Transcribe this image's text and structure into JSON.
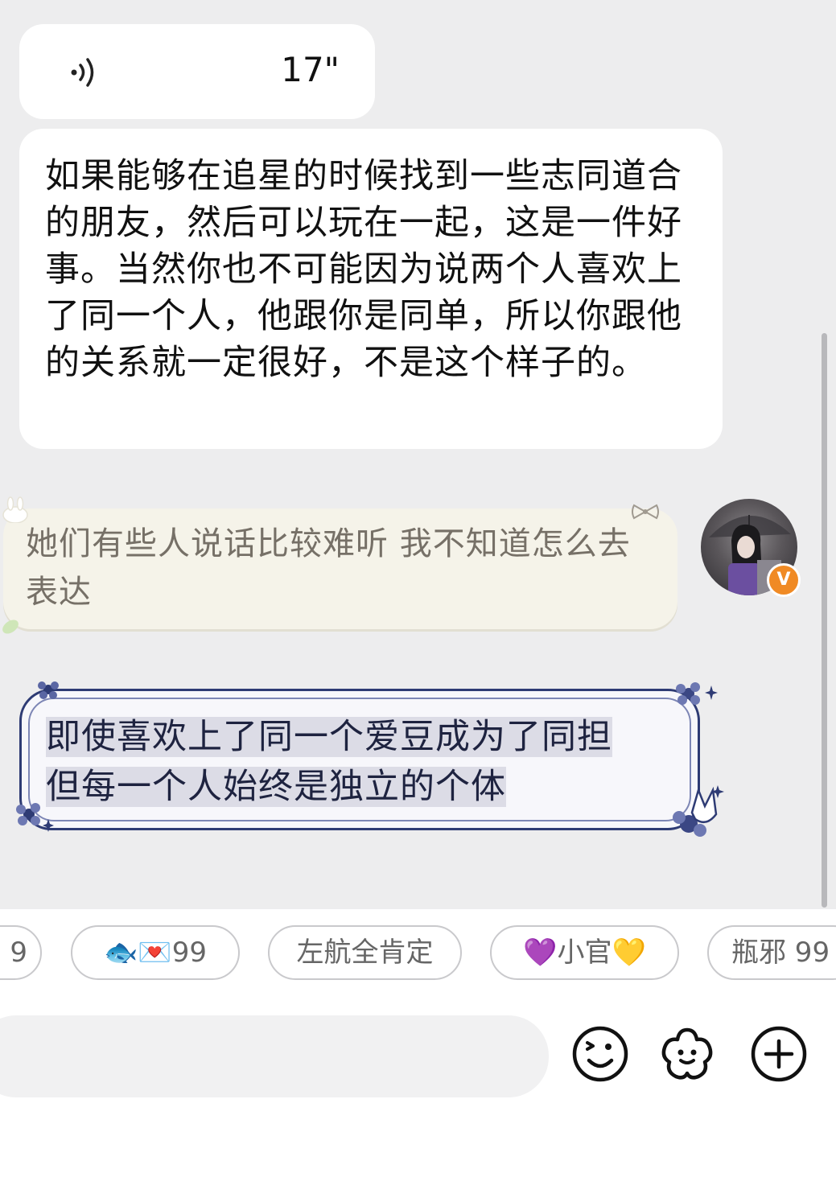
{
  "messages": [
    {
      "type": "voice",
      "duration": "17\""
    },
    {
      "type": "text",
      "text": "如果能够在追星的时候找到一些志同道合的朋友，然后可以玩在一起，这是一件好事。当然你也不可能因为说两个人喜欢上了同一个人，他跟你是同单，所以你跟他的关系就一定很好，不是这个样子的。"
    },
    {
      "type": "text",
      "text": "她们有些人说话比较难听 我不知道怎么去表达"
    },
    {
      "type": "text",
      "line1": "即使喜欢上了同一个爱豆成为了同担",
      "line2": "但每一个人始终是独立的个体"
    }
  ],
  "quick_replies": [
    "9",
    "🐟💌99",
    "左航全肯定",
    "💜小官💛",
    "瓶邪 99"
  ],
  "input": {
    "placeholder": ""
  },
  "icons": {
    "voice": "voice-wave-icon",
    "emoji": "smiley-icon",
    "sticker": "flower-sticker-icon",
    "add": "plus-icon",
    "verified": "verified-v-badge"
  },
  "badge": {
    "letter": "V",
    "color": "#f08a24"
  },
  "colors": {
    "chat_background": "#ededee",
    "cream_bubble": "#f5f3e9",
    "blue_bubble_border": "#2e3b74"
  }
}
